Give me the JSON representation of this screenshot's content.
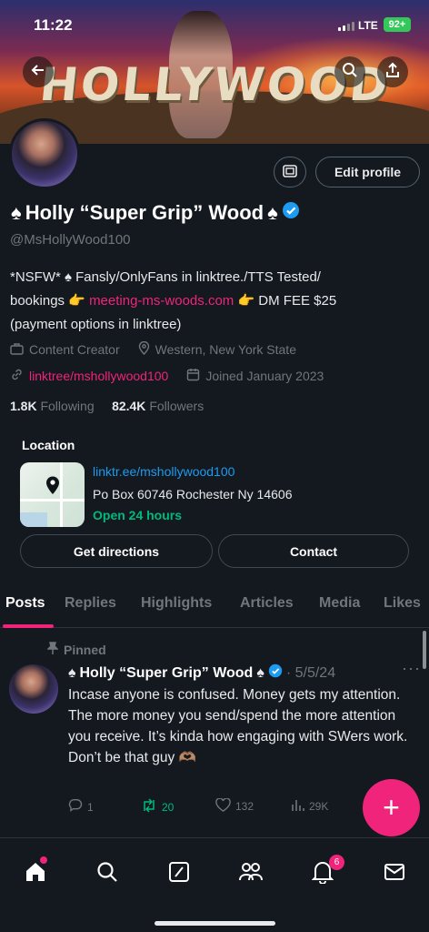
{
  "status_bar": {
    "time": "11:22",
    "network": "LTE",
    "battery": "92+"
  },
  "banner": {
    "sign_text": "HOLLYWOOD"
  },
  "profile": {
    "name": "Holly “Super Grip” Wood",
    "handle": "@MsHollyWood100",
    "edit_profile_label": "Edit profile",
    "bio_line1": "*NSFW* ♠ Fansly/OnlyFans in linktree./TTS Tested/",
    "bio_line2_pre": "bookings 👉 ",
    "bio_link": "meeting-ms-woods.com",
    "bio_line2_post": " 👉 DM FEE $25",
    "bio_line3": "(payment options in linktree)",
    "category": "Content Creator",
    "location": "Western, New York State",
    "website": "linktree/mshollywood100",
    "joined": "Joined January 2023",
    "following_count": "1.8K",
    "following_label": "Following",
    "followers_count": "82.4K",
    "followers_label": "Followers"
  },
  "location_card": {
    "title": "Location",
    "link": "linktr.ee/mshollywood100",
    "address": "Po Box 60746 Rochester Ny 14606",
    "hours": "Open 24 hours",
    "directions_label": "Get directions",
    "contact_label": "Contact"
  },
  "tabs": [
    "Posts",
    "Replies",
    "Highlights",
    "Articles",
    "Media",
    "Likes"
  ],
  "post": {
    "pinned_label": "Pinned",
    "author": "Holly “Super Grip” Wood",
    "date": "· 5/5/24",
    "body": "Incase anyone is confused. Money gets my attention. The more money you send/spend the more attention you receive. It’s kinda how engaging with SWers work. Don’t be that guy 🫶🏽",
    "replies": "1",
    "reposts": "20",
    "likes": "132",
    "views": "29K"
  },
  "nav": {
    "notifications_badge": "6"
  },
  "colors": {
    "accent": "#f0247a",
    "verified": "#1d9bf0",
    "repost": "#00ba7c",
    "background": "#14181f"
  }
}
